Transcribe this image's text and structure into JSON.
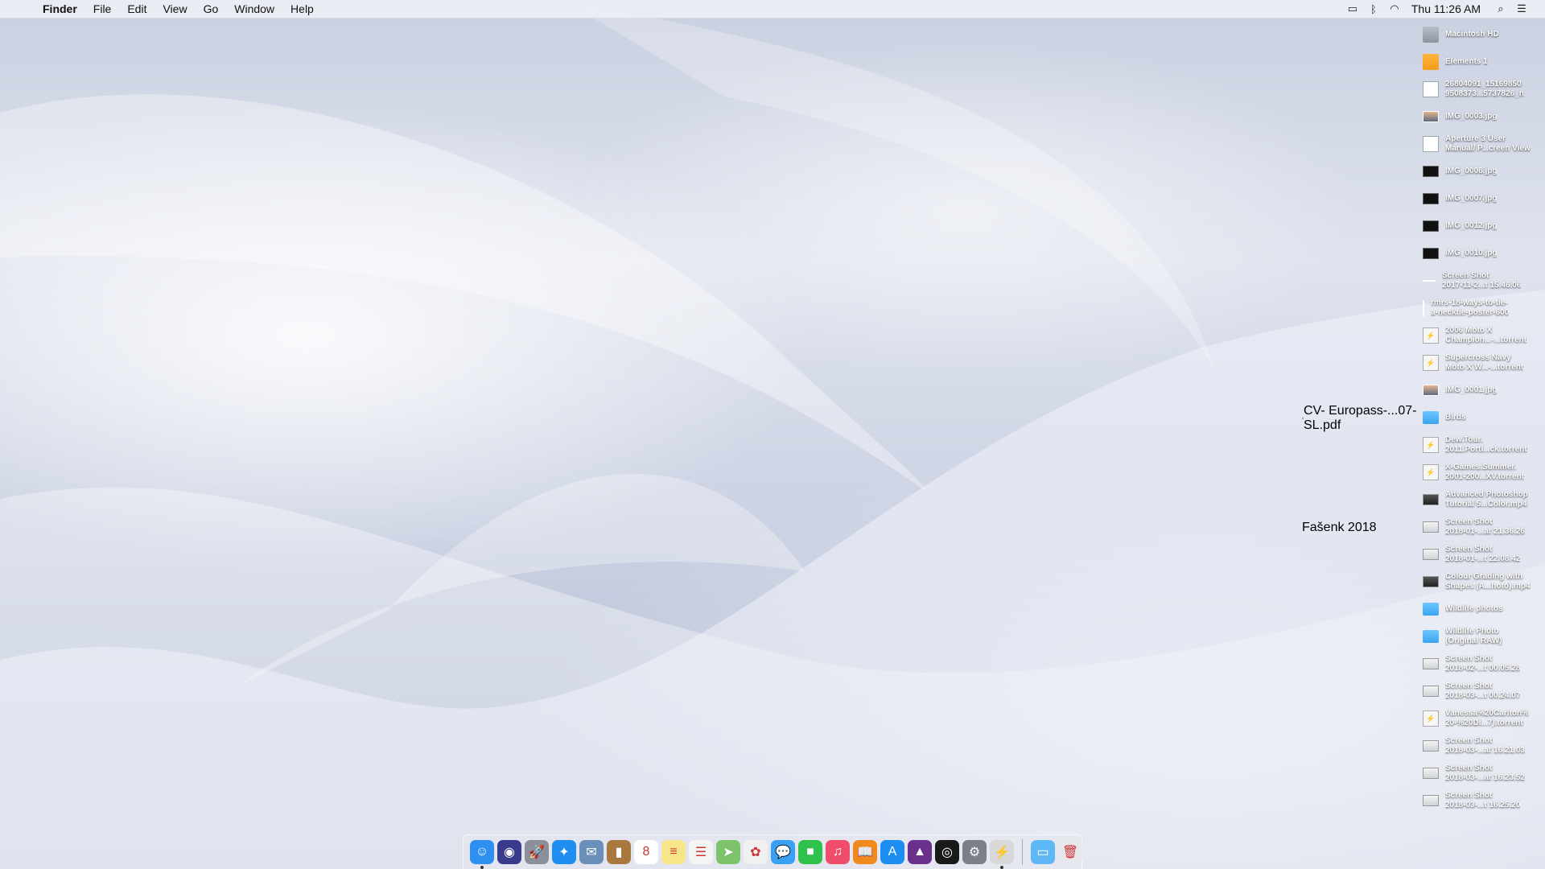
{
  "menubar": {
    "app_name": "Finder",
    "menus": [
      "File",
      "Edit",
      "View",
      "Go",
      "Window",
      "Help"
    ],
    "clock": "Thu 11:26 AM"
  },
  "desktop_items": [
    {
      "label": "Macintosh HD",
      "kind": "disk"
    },
    {
      "label": "Elements 1",
      "kind": "ext"
    },
    {
      "label": "26804091_15169850\n9508373...5737826_n",
      "kind": "doc"
    },
    {
      "label": "IMG_0003.jpg",
      "kind": "photo"
    },
    {
      "label": "Aperture 3 User\nManual/ P...creen View",
      "kind": "doc"
    },
    {
      "label": "IMG_0006.jpg",
      "kind": "dark"
    },
    {
      "label": "IMG_0007.jpg",
      "kind": "dark"
    },
    {
      "label": "IMG_0012.jpg",
      "kind": "dark"
    },
    {
      "label": "IMG_0010.jpg",
      "kind": "dark"
    },
    {
      "label": "Screen Shot\n2017-11-2...t 15.46.06",
      "kind": "line"
    },
    {
      "label": "rmrs-18-ways-to-tie-\na-necktie-poster-600",
      "kind": "vline"
    },
    {
      "label": "2006 Moto X\nChampion...-...torrent",
      "kind": "torrent"
    },
    {
      "label": "Supercross Navy\nMoto X W...-...torrent",
      "kind": "torrent"
    },
    {
      "label": "IMG_0001.jpg",
      "kind": "photo"
    },
    {
      "label": "Birds",
      "kind": "folder"
    },
    {
      "label": "Dew.Tour.\n2011.Portl...ck.torrent",
      "kind": "torrent"
    },
    {
      "label": "X-Games.Summer.\n2001-200...XV.torrent",
      "kind": "torrent"
    },
    {
      "label": "Advanced Photoshop\nTutorial 5...Color.mp4",
      "kind": "video"
    },
    {
      "label": "Screen Shot\n2018-01-...at 21.36.26",
      "kind": "shot"
    },
    {
      "label": "Screen Shot\n2018-01-...t 22.08.42",
      "kind": "shot"
    },
    {
      "label": "Colour Grading with\nShapes (A...hoto).mp4",
      "kind": "video"
    },
    {
      "label": "Wildlife photos",
      "kind": "folder"
    },
    {
      "label": "Wildlife Photo\n(Original RAW)",
      "kind": "folder"
    },
    {
      "label": "Screen Shot\n2018-02-...t 00.05.28",
      "kind": "shot"
    },
    {
      "label": "Screen Shot\n2018-03-...t 00.24.07",
      "kind": "shot"
    },
    {
      "label": "Vanessa%20Carlton%\n20-%20Di...7).torrent",
      "kind": "torrent"
    },
    {
      "label": "Screen Shot\n2018-03-...at 16.21.03",
      "kind": "shot"
    },
    {
      "label": "Screen Shot\n2018-03-...at 16.23.52",
      "kind": "shot"
    },
    {
      "label": "Screen Shot\n2018-03-...t 16.25.20",
      "kind": "shot"
    }
  ],
  "free_items": [
    {
      "label": "CV-\nEuropass-...07-SL.pdf",
      "kind": "doc"
    },
    {
      "label": "Fašenk 2018",
      "kind": "folder"
    }
  ],
  "dock": {
    "apps": [
      {
        "name": "finder",
        "icon": "finder-icon",
        "color": "#2f8ff0",
        "glyph": "☺",
        "running": true
      },
      {
        "name": "siri",
        "icon": "siri-icon",
        "color": "#3a3a8c",
        "glyph": "◉",
        "running": false
      },
      {
        "name": "launchpad",
        "icon": "launchpad-icon",
        "color": "#8a8f99",
        "glyph": "🚀",
        "running": false
      },
      {
        "name": "safari",
        "icon": "safari-icon",
        "color": "#1e8ef0",
        "glyph": "✦",
        "running": false
      },
      {
        "name": "mail-stamp",
        "icon": "mail-icon",
        "color": "#6a8fb8",
        "glyph": "✉",
        "running": false
      },
      {
        "name": "contacts",
        "icon": "contacts-icon",
        "color": "#a7793f",
        "glyph": "▮",
        "running": false
      },
      {
        "name": "calendar",
        "icon": "calendar-icon",
        "color": "#ffffff",
        "glyph": "8",
        "running": false
      },
      {
        "name": "notes",
        "icon": "notes-icon",
        "color": "#f7e68a",
        "glyph": "≡",
        "running": false
      },
      {
        "name": "reminders",
        "icon": "reminders-icon",
        "color": "#f4f4f4",
        "glyph": "☰",
        "running": false
      },
      {
        "name": "maps",
        "icon": "maps-icon",
        "color": "#7cc36b",
        "glyph": "➤",
        "running": false
      },
      {
        "name": "photos",
        "icon": "photos-icon",
        "color": "#f0f0f0",
        "glyph": "✿",
        "running": false
      },
      {
        "name": "messages",
        "icon": "messages-icon",
        "color": "#3aa0f5",
        "glyph": "💬",
        "running": false
      },
      {
        "name": "facetime",
        "icon": "facetime-icon",
        "color": "#2ec14b",
        "glyph": "■",
        "running": false
      },
      {
        "name": "itunes",
        "icon": "itunes-icon",
        "color": "#f04d6a",
        "glyph": "♫",
        "running": false
      },
      {
        "name": "ibooks",
        "icon": "ibooks-icon",
        "color": "#f08a1e",
        "glyph": "📖",
        "running": false
      },
      {
        "name": "app-store",
        "icon": "app-store-icon",
        "color": "#1c8ef2",
        "glyph": "A",
        "running": false
      },
      {
        "name": "affinity-photo",
        "icon": "affinity-icon",
        "color": "#6b2f8c",
        "glyph": "▲",
        "running": false
      },
      {
        "name": "camera-raw",
        "icon": "aperture-icon",
        "color": "#1a1a1a",
        "glyph": "◎",
        "running": false
      },
      {
        "name": "system-preferences",
        "icon": "system-preferences-icon",
        "color": "#7a7f88",
        "glyph": "⚙",
        "running": false
      },
      {
        "name": "transmission",
        "icon": "transmission-icon",
        "color": "#d8d8d8",
        "glyph": "⚡",
        "running": true
      }
    ],
    "stacks": [
      {
        "name": "downloads-folder",
        "icon": "folder-icon",
        "color": "#5db8f5",
        "glyph": "▭"
      },
      {
        "name": "trash",
        "icon": "trash-icon",
        "color": "#e6e8ec",
        "glyph": "🗑"
      }
    ]
  }
}
